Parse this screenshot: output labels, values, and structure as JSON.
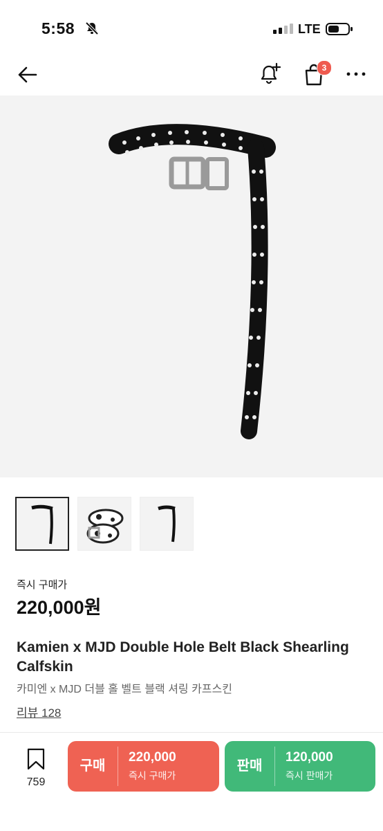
{
  "status_bar": {
    "time": "5:58",
    "network": "LTE"
  },
  "header": {
    "cart_badge": "3"
  },
  "thumbnails": [
    {
      "name": "belt-thumb-1",
      "selected": true
    },
    {
      "name": "belt-thumb-2",
      "selected": false
    },
    {
      "name": "belt-thumb-3",
      "selected": false
    }
  ],
  "product": {
    "price_label": "즉시 구매가",
    "price": "220,000원",
    "title_en": "Kamien x MJD Double Hole Belt Black Shearling Calfskin",
    "title_ko": "카미엔 x MJD 더블 홀 벨트 블랙 셔링 카프스킨",
    "review_link": "리뷰 128"
  },
  "bottom_bar": {
    "bookmark_count": "759",
    "buy": {
      "label": "구매",
      "price": "220,000",
      "sub": "즉시 구매가"
    },
    "sell": {
      "label": "판매",
      "price": "120,000",
      "sub": "즉시 판매가"
    }
  },
  "colors": {
    "buy": "#ef6253",
    "sell": "#41b979",
    "badge": "#ef5a4f"
  }
}
